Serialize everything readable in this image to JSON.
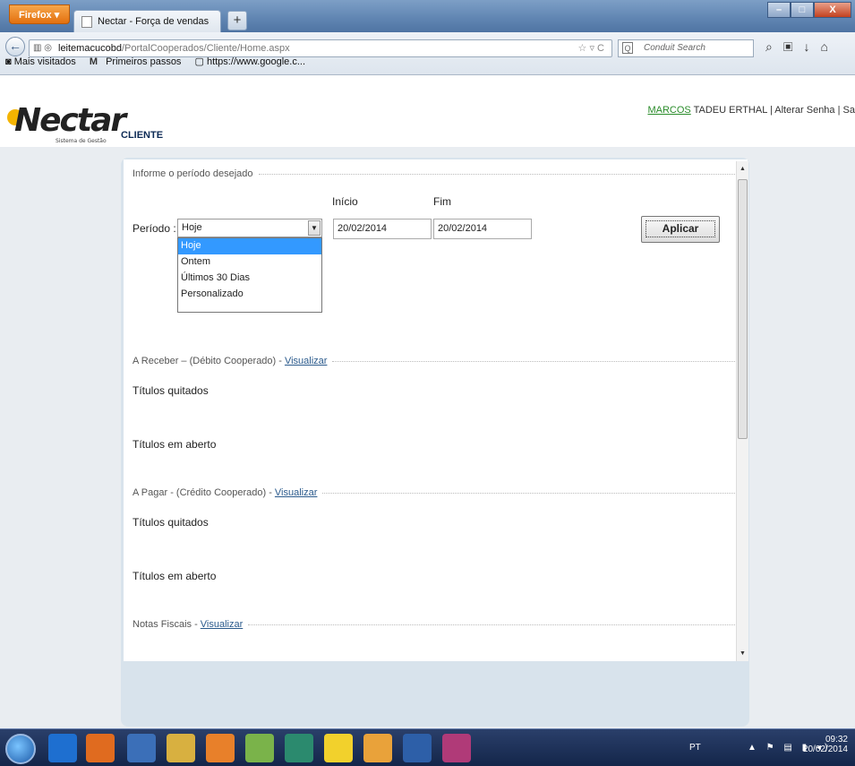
{
  "browser": {
    "menu_label": "Firefox",
    "tab_title": "Nectar - Força de vendas",
    "new_tab": "+",
    "url_host": "leitemacucobd",
    "url_path": "/PortalCooperados/Cliente/Home.aspx",
    "search_placeholder": "Conduit Search",
    "bookmarks": [
      "Mais visitados",
      "Primeiros passos",
      "https://www.google.c..."
    ]
  },
  "header": {
    "logo": "Nectar",
    "logo_sub": "Sistema de Gestão",
    "section": "CLIENTE",
    "user_first": "MARCOS",
    "user_rest": " TADEU ERTHAL",
    "sep": "|",
    "change_password": "Alterar Senha",
    "exit": "Sa"
  },
  "period": {
    "legend": "Informe o período desejado",
    "label": "Período :",
    "selected": "Hoje",
    "options": [
      "Hoje",
      "Ontem",
      "Últimos 30 Dias",
      "Personalizado"
    ],
    "start_label": "Início",
    "end_label": "Fim",
    "start_value": "20/02/2014",
    "end_value": "20/02/2014",
    "apply": "Aplicar"
  },
  "sections": [
    {
      "legend": "A Receber – (Débito Cooperado) -",
      "link": "Visualizar",
      "rows": [
        "Títulos quitados",
        "Títulos em aberto"
      ]
    },
    {
      "legend": "A Pagar - (Crédito Cooperado) -",
      "link": "Visualizar",
      "rows": [
        "Títulos quitados",
        "Títulos em aberto"
      ]
    },
    {
      "legend": "Notas Fiscais -",
      "link": "Visualizar"
    }
  ],
  "taskbar": {
    "lang": "PT",
    "time": "09:32",
    "date": "20/02/2014"
  }
}
